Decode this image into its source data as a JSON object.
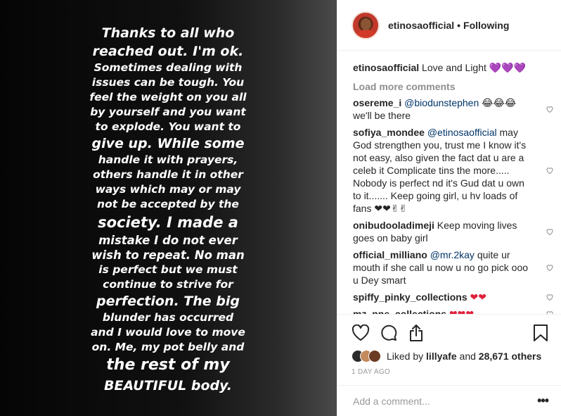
{
  "story": {
    "lines": [
      "Thanks to all who",
      "reached out. I'm ok.",
      "Sometimes dealing with",
      "issues can be tough. You",
      "feel the weight on you all",
      "by yourself and you want",
      "to explode. You want to",
      "give up. While some",
      "handle it with prayers,",
      "others handle it in other",
      "ways which may or may",
      "not be accepted by the",
      "society. I made a",
      "mistake I do not ever",
      "wish to repeat. No man",
      "is perfect but we must",
      "continue to strive for",
      "perfection. The big",
      "blunder has occurred",
      "and I would love to move",
      "on. Me, my pot belly and",
      "the rest of my",
      "BEAUTIFUL body."
    ]
  },
  "header": {
    "username": "etinosaofficial",
    "separator": "•",
    "follow_status": "Following"
  },
  "caption": {
    "username": "etinosaofficial",
    "text": "Love and Light",
    "emoji": "💜💜💜"
  },
  "load_more": "Load more comments",
  "comments": [
    {
      "username": "osereme_i",
      "mention": "@biodunstephen",
      "text": "😂😂😂 we'll be there"
    },
    {
      "username": "sofiya_mondee",
      "mention": "@etinosaofficial",
      "text": "may God strengthen you, trust me I know it's not easy, also given the fact dat u are a celeb it Complicate tins the more..... Nobody is perfect nd it's Gud dat u own to it....... Keep going girl, u hv loads of fans ❤❤✌✌"
    },
    {
      "username": "onibudooladimeji",
      "mention": "",
      "text": "Keep moving lives goes on baby girl"
    },
    {
      "username": "official_milliano",
      "mention": "@mr.2kay",
      "text": "quite ur mouth if she call u now u no go pick ooo u Dey smart"
    },
    {
      "username": "spiffy_pinky_collections",
      "mention": "",
      "text": "❤❤"
    },
    {
      "username": "mz_nne_collections",
      "mention": "",
      "text": "❤❤❤"
    }
  ],
  "likes": {
    "prefix": "Liked by",
    "user": "lillyafe",
    "and": "and",
    "others": "28,671 others"
  },
  "date": "1 DAY AGO",
  "add_comment": {
    "placeholder": "Add a comment...",
    "more": "•••"
  },
  "icons": {
    "like": "heart-icon",
    "comment": "comment-icon",
    "share": "share-icon",
    "save": "bookmark-icon",
    "comment_like": "small-heart-icon"
  },
  "colors": {
    "mention": "#003569",
    "muted": "#8e8e8e",
    "purple_heart": "#8e44ec",
    "red_heart": "#e0203a"
  }
}
